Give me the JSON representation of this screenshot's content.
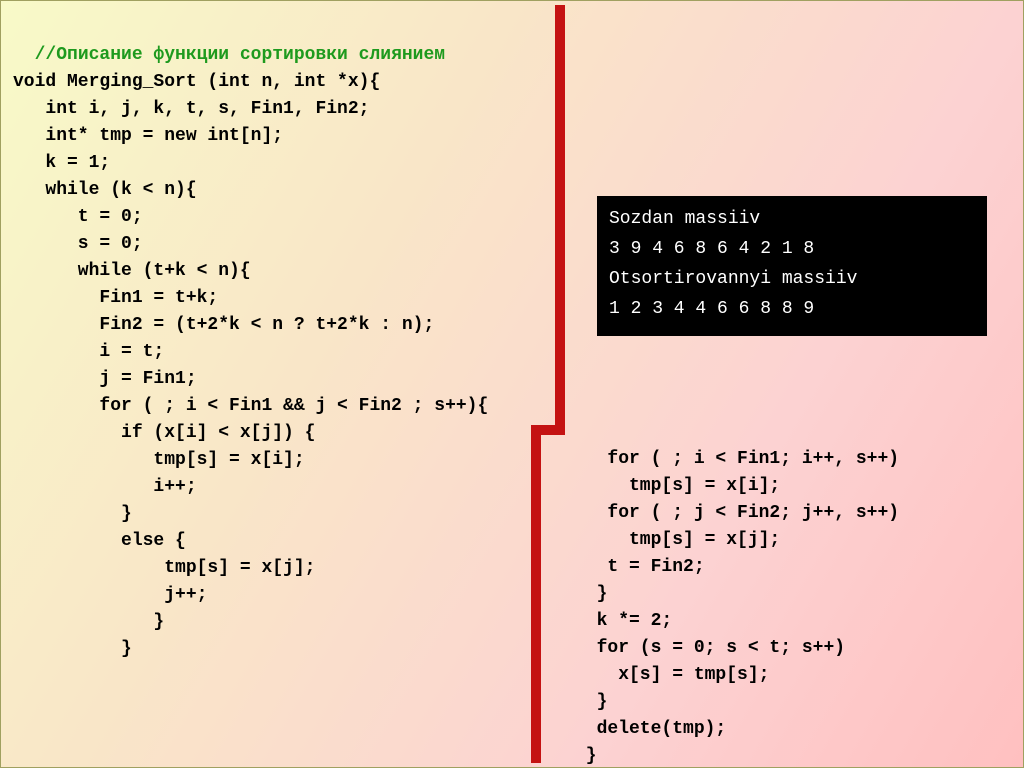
{
  "comment": "//Описание функции сортировки слиянием",
  "code_left": "void Merging_Sort (int n, int *x){\n   int i, j, k, t, s, Fin1, Fin2;\n   int* tmp = new int[n];\n   k = 1;\n   while (k < n){\n      t = 0;\n      s = 0;\n      while (t+k < n){\n        Fin1 = t+k;\n        Fin2 = (t+2*k < n ? t+2*k : n);\n        i = t;\n        j = Fin1;\n        for ( ; i < Fin1 && j < Fin2 ; s++){\n          if (x[i] < x[j]) {\n             tmp[s] = x[i];\n             i++;\n          }\n          else {\n              tmp[s] = x[j];\n              j++;\n             }\n          }",
  "code_right": "   for ( ; i < Fin1; i++, s++)\n     tmp[s] = x[i];\n   for ( ; j < Fin2; j++, s++)\n     tmp[s] = x[j];\n   t = Fin2;\n  }\n  k *= 2;\n  for (s = 0; s < t; s++)\n    x[s] = tmp[s];\n  }\n  delete(tmp);\n }",
  "console": {
    "line1": "Sozdan massiiv",
    "line2": "3 9 4 6 8 6 4 2 1 8",
    "line3": "Otsortirovannyi massiiv",
    "line4": "1 2 3 4 4 6 6 8 8 9"
  }
}
